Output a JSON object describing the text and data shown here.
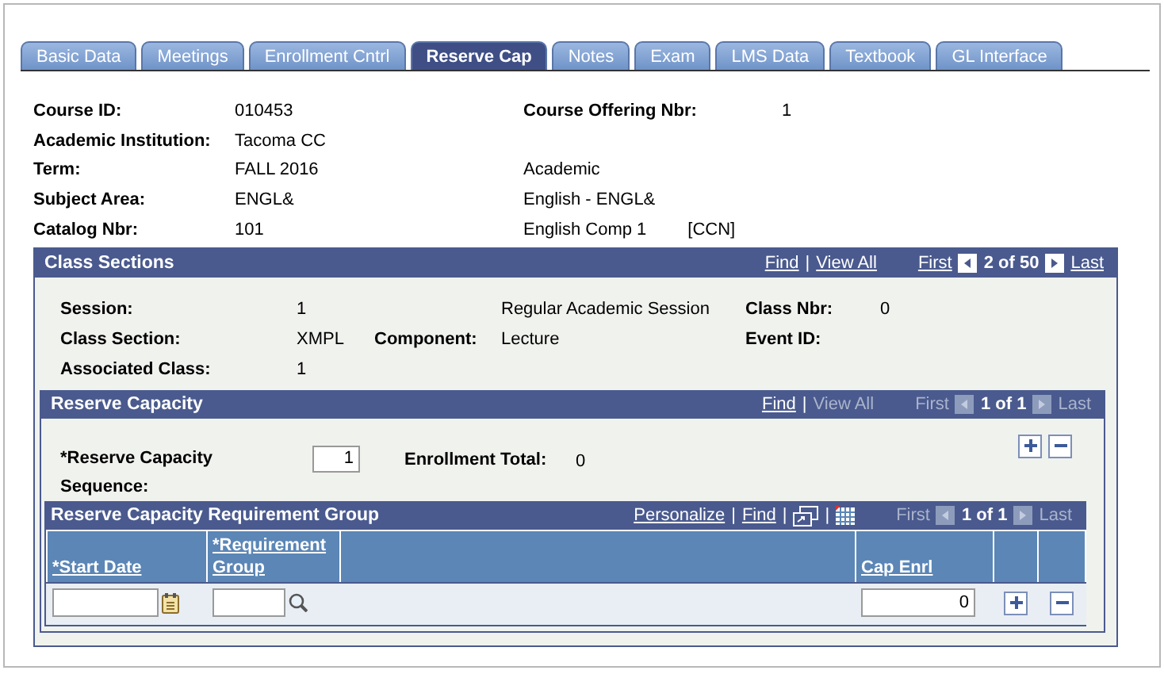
{
  "tabs": [
    {
      "label": "Basic Data",
      "selected": false
    },
    {
      "label": "Meetings",
      "selected": false
    },
    {
      "label": "Enrollment Cntrl",
      "selected": false
    },
    {
      "label": "Reserve Cap",
      "selected": true
    },
    {
      "label": "Notes",
      "selected": false
    },
    {
      "label": "Exam",
      "selected": false
    },
    {
      "label": "LMS Data",
      "selected": false
    },
    {
      "label": "Textbook",
      "selected": false
    },
    {
      "label": "GL Interface",
      "selected": false
    }
  ],
  "course": {
    "rows": [
      {
        "label": "Course ID:",
        "value": "010453",
        "label_2": "Course Offering Nbr:",
        "value_2": "1"
      },
      {
        "label": "Academic Institution:",
        "value": "Tacoma CC"
      },
      {
        "label": "Term:",
        "value": "FALL 2016",
        "text_2": "Academic"
      },
      {
        "label": "Subject Area:",
        "value": "ENGL&",
        "text_2": "English - ENGL&"
      },
      {
        "label": "Catalog Nbr:",
        "value": "101",
        "text_2": "English Comp 1",
        "note": "[CCN]"
      }
    ]
  },
  "class_sections": {
    "title": "Class Sections",
    "nav": {
      "separator": "|",
      "links": [
        {
          "label": "Find",
          "disabled": false
        },
        {
          "label": "View All",
          "disabled": false
        }
      ],
      "first": {
        "label": "First",
        "disabled": false
      },
      "counter": "2 of 50",
      "last": {
        "label": "Last",
        "disabled": false
      }
    },
    "rows": [
      {
        "label": "Session:",
        "value": "1",
        "value_2": "Regular Academic Session",
        "label_3": "Class Nbr:",
        "value_3": "0"
      },
      {
        "label": "Class Section:",
        "value": "XMPL",
        "label_2": "Component:",
        "value_2": "Lecture",
        "label_3": "Event ID:"
      },
      {
        "label": "Associated Class:",
        "value": "1"
      }
    ],
    "reserve_capacity": {
      "title": "Reserve Capacity",
      "nav": {
        "separator": "|",
        "links": [
          {
            "label": "Find",
            "disabled": false
          },
          {
            "label": "View All",
            "disabled": true
          }
        ],
        "first": {
          "label": "First",
          "disabled": true
        },
        "counter": "1 of 1",
        "last": {
          "label": "Last",
          "disabled": true
        }
      },
      "sequence_label": "*Reserve Capacity Sequence:",
      "sequence_value": "1",
      "enrollment_label": "Enrollment Total:",
      "enrollment_value": "0",
      "requirement_group": {
        "title": "Reserve Capacity Requirement Group",
        "nav": {
          "separator": "|",
          "links": [
            {
              "label": "Personalize",
              "disabled": false
            },
            {
              "label": "Find",
              "disabled": false
            }
          ],
          "first": {
            "label": "First",
            "disabled": true
          },
          "counter": "1 of 1",
          "last": {
            "label": "Last",
            "disabled": true
          }
        },
        "columns": [
          "*Start Date",
          "*Requirement Group",
          "Cap Enrl"
        ],
        "rows": [
          {
            "cap_enrl": "0"
          }
        ]
      }
    }
  }
}
